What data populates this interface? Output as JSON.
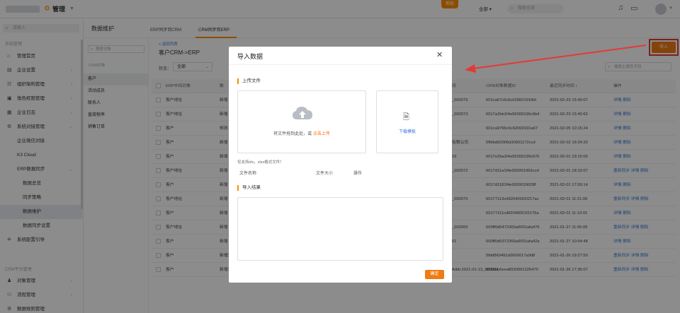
{
  "topbar": {
    "app_name": "管理",
    "help_label": "帮助",
    "scope_select": "全部",
    "search_placeholder": "搜索全部"
  },
  "sidebar": {
    "search_placeholder": "请输入",
    "group1": "系统管理",
    "items": [
      {
        "label": "管理首页",
        "icon": "home-icon",
        "has_children": false
      },
      {
        "label": "企业设置",
        "icon": "building-icon",
        "has_children": true
      },
      {
        "label": "组织架构管理",
        "icon": "org-icon",
        "has_children": true
      },
      {
        "label": "角色权限管理",
        "icon": "role-icon",
        "has_children": true
      },
      {
        "label": "企业日志",
        "icon": "log-icon",
        "has_children": true
      },
      {
        "label": "系统对接管理",
        "icon": "link-icon",
        "has_children": true
      }
    ],
    "sub_items": [
      "企业微信对接",
      "K3 Cloud",
      "ERP数据同步"
    ],
    "erp_sub": [
      "数据总览",
      "同步策略",
      "数据维护",
      "数据同步设置"
    ],
    "guide": "系统配置引导",
    "group2": "CRM平台管理",
    "bottom_items": [
      {
        "label": "对象管理"
      },
      {
        "label": "流程管理"
      },
      {
        "label": "数据规则管理"
      }
    ]
  },
  "main": {
    "title": "数据维护",
    "tabs": [
      "ERP同步到CRM",
      "CRM同步到ERP"
    ],
    "sub_search_placeholder": "搜索对象",
    "sub_label": "CRM对象",
    "sub_items": [
      "客户",
      "活动成员",
      "联系人",
      "直接税率",
      "销售订单"
    ],
    "back_link": "< 返回列表",
    "crm_title": "客户CRM->ERP",
    "status_label": "状态：",
    "status_value": "全部",
    "import_label": "导入",
    "field_search_placeholder": "搜索主属性字段"
  },
  "table": {
    "headers": [
      "ERP中间对象",
      "数",
      "段",
      "CRM对象数据ID",
      "最近同步时间 ↕",
      "操作"
    ],
    "rows": [
      {
        "obj": "客户地址",
        "n": "新增",
        "seg": "_002075",
        "id": "601ca67c6c6c62000191fb0",
        "time": "2021-02-23 15:40:07",
        "ops": "详情  删除"
      },
      {
        "obj": "客户地址",
        "n": "新增",
        "seg": "_002073",
        "id": "6017a2bb1f4e92000196c6b4",
        "time": "2021-02-23 15:40:62",
        "ops": "详情  删除"
      },
      {
        "obj": "客户",
        "n": "修改",
        "seg": "",
        "id": "601ca9796c6c62000191a67",
        "time": "2021-02-05 10:15:24",
        "ops": "详情  删除"
      },
      {
        "obj": "客户",
        "n": "新增",
        "seg": "有限公司",
        "id": "5ffdbd02006d30001172ccd",
        "time": "2021-02-02 16:24:20",
        "ops": "详情  删除"
      },
      {
        "obj": "客户",
        "n": "新增",
        "seg": "23",
        "id": "6017e2ba1f4e92000199c676",
        "time": "2021-02-01 19:15:05",
        "ops": "详情  删除"
      },
      {
        "obj": "客户地址",
        "n": "新增",
        "seg": "_002072",
        "id": "6017d11a1f4e920001962ccd",
        "time": "2021-02-01 18:10:07",
        "ops": "重新同步  详情  删除"
      },
      {
        "obj": "客户",
        "n": "新增",
        "seg": "",
        "id": "6017d1181f4e9200019628f",
        "time": "2021-02-01 17:59:14",
        "ops": "详情  删除"
      },
      {
        "obj": "客户地址",
        "n": "新增",
        "seg": "_002070",
        "id": "60177113cd92040001f217ac",
        "time": "2021-02-01 11:21:06",
        "ops": "重新同步  详情  删除"
      },
      {
        "obj": "客户",
        "n": "新增",
        "seg": "",
        "id": "60177111cd92040001f2176a",
        "time": "2021-02-01 11:10:01",
        "ops": "详情  删除"
      },
      {
        "obj": "客户地址",
        "n": "新增",
        "seg": "_002065",
        "id": "600ff0d5472365a0001afa476",
        "time": "2021-01-27 11:05:09",
        "ops": "重新同步  详情  删除"
      },
      {
        "obj": "客户",
        "n": "新增",
        "seg": "01",
        "id": "600ff0d5372365a0001afa42a",
        "time": "2021-01-27 10:54:48",
        "ops": "详情  删除"
      },
      {
        "obj": "客户",
        "n": "新增失败",
        "seg": "",
        "id": "5fdd860491d2600017a9d8",
        "time": "2021-01-26 19:27:50",
        "ops": "重新同步  详情  删除"
      },
      {
        "obj": "客户",
        "n": "新增失败",
        "seg": "Addr.2021-01-13_002051",
        "id": "601ebc6eea8930001225470",
        "time": "2021-01-26 17:36:07",
        "ops": "重新同步  详情  删除"
      }
    ]
  },
  "modal": {
    "title": "导入数据",
    "upload_section": "上传文件",
    "drop_text": "将文件拖到此处，或 ",
    "drop_link": "点击上传",
    "template_label": "下载模板",
    "hint": "仅支持xls，xlsx格式文件！",
    "file_cols": [
      "文件名称",
      "文件大小",
      "操作"
    ],
    "result_section": "导入结果",
    "ok_label": "确定"
  },
  "colors": {
    "accent": "#f07a13",
    "link": "#3a7bd5",
    "annotation_red": "#e53935"
  }
}
